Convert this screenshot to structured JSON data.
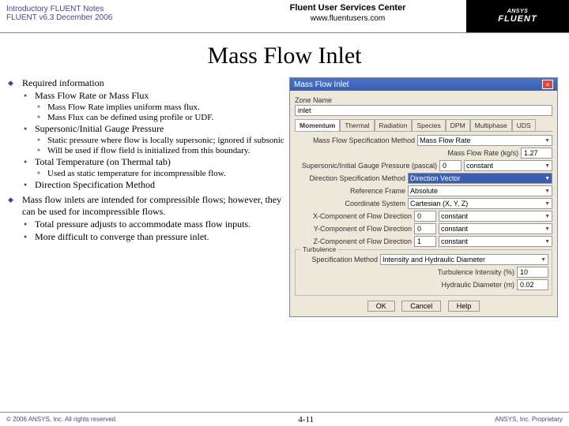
{
  "header": {
    "left1": "Introductory FLUENT Notes",
    "left2": "FLUENT v6.3 December 2006",
    "center1": "Fluent User Services Center",
    "center2": "www.fluentusers.com",
    "brand": "ANSYS",
    "sub": "FLUENT"
  },
  "title": "Mass Flow Inlet",
  "bullets": {
    "b1": "Required information",
    "b1a": "Mass Flow Rate or Mass Flux",
    "b1a1": "Mass Flow Rate implies uniform mass flux.",
    "b1a2": "Mass Flux can be defined using profile or UDF.",
    "b1b": "Supersonic/Initial Gauge Pressure",
    "b1b1": "Static pressure where flow is locally supersonic; ignored if subsonic",
    "b1b2": "Will be used if flow field is initialized from this boundary.",
    "b1c": "Total Temperature (on Thermal tab)",
    "b1c1": "Used as static temperature for incompressible flow.",
    "b1d": "Direction Specification Method",
    "b2": "Mass flow inlets are intended for compressible flows; however, they can be used for incompressible flows.",
    "b2a": "Total pressure adjusts to accommodate mass flow inputs.",
    "b2b": "More difficult to converge than pressure inlet."
  },
  "dlg": {
    "title": "Mass Flow Inlet",
    "zoneNameLbl": "Zone Name",
    "zoneName": "inlet",
    "tabs": [
      "Momentum",
      "Thermal",
      "Radiation",
      "Species",
      "DPM",
      "Multiphase",
      "UDS"
    ],
    "mfsmLbl": "Mass Flow Specification Method",
    "mfsm": "Mass Flow Rate",
    "mfrLbl": "Mass Flow Rate (kg/s)",
    "mfr": "1.27",
    "sigpLbl": "Supersonic/Initial Gauge Pressure (pascal)",
    "sigp": "0",
    "sigpSel": "constant",
    "dsmLbl": "Direction Specification Method",
    "dsm": "Direction Vector",
    "refLbl": "Reference Frame",
    "ref": "Absolute",
    "csLbl": "Coordinate System",
    "cs": "Cartesian (X, Y, Z)",
    "xcLbl": "X-Component of Flow Direction",
    "xc": "0",
    "ycLbl": "Y-Component of Flow Direction",
    "yc": "0",
    "zcLbl": "Z-Component of Flow Direction",
    "zc": "1",
    "turbLbl": "Turbulence",
    "smLbl": "Specification Method",
    "sm": "Intensity and Hydraulic Diameter",
    "tiLbl": "Turbulence Intensity (%)",
    "ti": "10",
    "hdLbl": "Hydraulic Diameter (m)",
    "hd": "0.02",
    "ok": "OK",
    "cancel": "Cancel",
    "help": "Help"
  },
  "footer": {
    "left": "© 2006 ANSYS, Inc. All rights reserved.",
    "page": "4-11",
    "right": "ANSYS, Inc. Proprietary"
  }
}
